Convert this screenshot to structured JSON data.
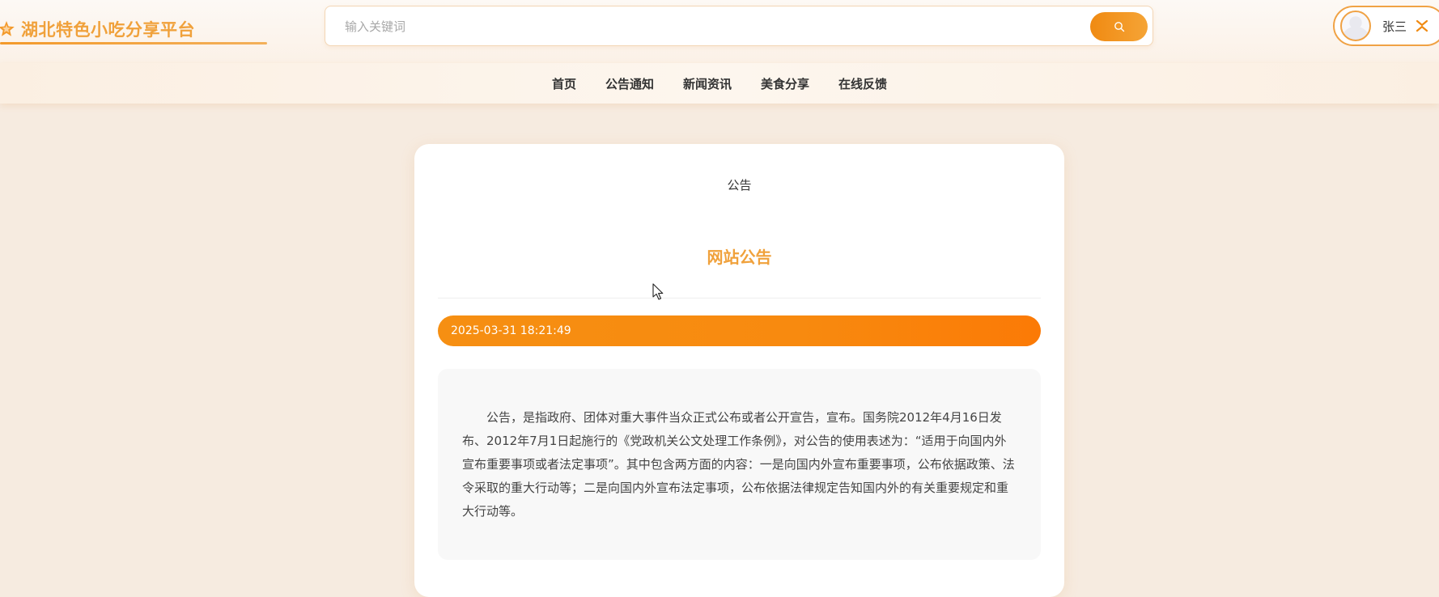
{
  "header": {
    "logo_text": "湖北特色小吃分享平台",
    "search": {
      "placeholder": "输入关键词"
    },
    "user": {
      "name": "张三"
    }
  },
  "nav": {
    "items": [
      "首页",
      "公告通知",
      "新闻资讯",
      "美食分享",
      "在线反馈"
    ]
  },
  "article": {
    "breadcrumb": "公告",
    "title": "网站公告",
    "date": "2025-03-31 18:21:49",
    "content": "公告，是指政府、团体对重大事件当众正式公布或者公开宣告，宣布。国务院2012年4月16日发布、2012年7月1日起施行的《党政机关公文处理工作条例》，对公告的使用表述为：“适用于向国内外宣布重要事项或者法定事项”。其中包含两方面的内容：一是向国内外宣布重要事项，公布依据政策、法令采取的重大行动等；二是向国内外宣布法定事项，公布依据法律规定告知国内外的有关重要规定和重大行动等。"
  },
  "colors": {
    "accent": "#f0a13b",
    "button": "#f08a12",
    "date_bar": "#f88a0f"
  },
  "icons": {
    "logo": "star-icon",
    "search": "search-icon",
    "toggle": "collapse-icon",
    "cursor": "mouse-pointer-icon"
  }
}
